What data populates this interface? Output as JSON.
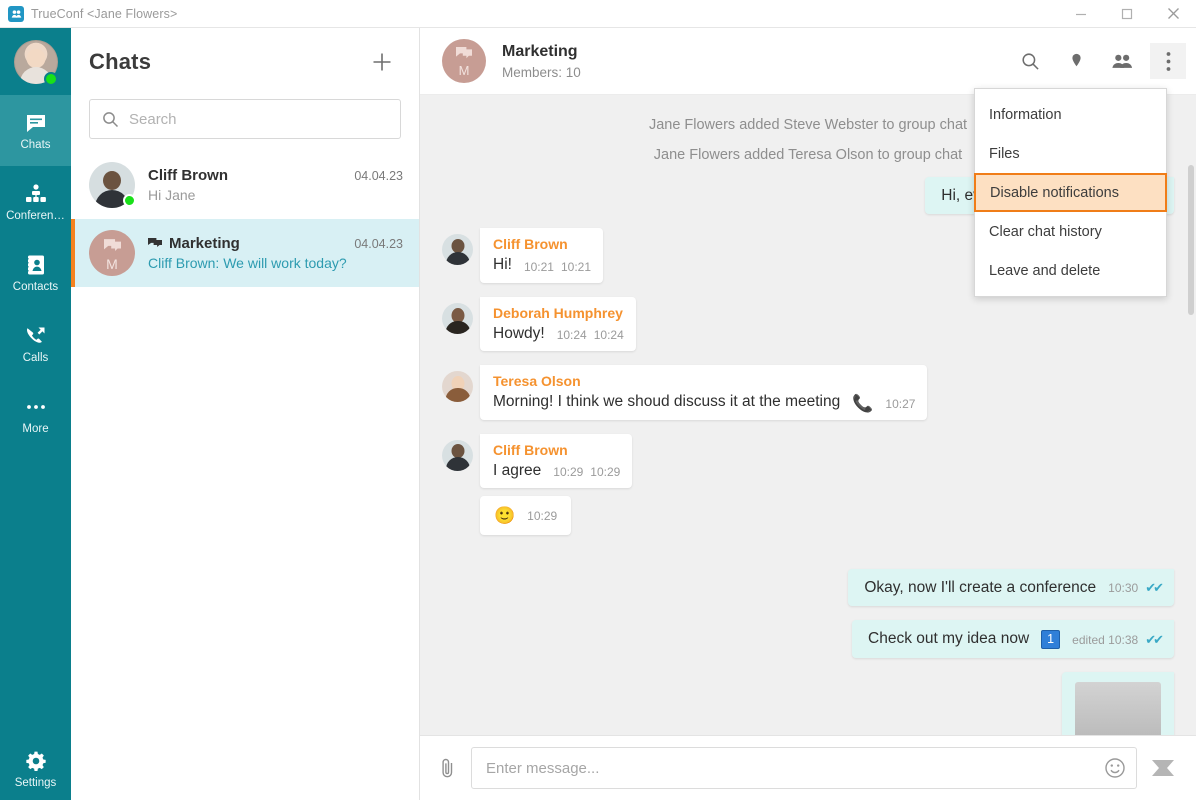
{
  "window": {
    "title": "TrueConf <Jane Flowers>",
    "logo_icon": "trueconf-logo-icon",
    "minimize_label": "—",
    "maximize_label": "☐",
    "close_label": "✕"
  },
  "rail": {
    "avatar_name": "user-avatar",
    "status": "online",
    "items": [
      {
        "label": "Chats",
        "icon": "chat-icon",
        "active": true
      },
      {
        "label": "Conferen…",
        "icon": "conference-icon",
        "active": false
      },
      {
        "label": "Contacts",
        "icon": "contacts-icon",
        "active": false
      },
      {
        "label": "Calls",
        "icon": "calls-icon",
        "active": false
      },
      {
        "label": "More",
        "icon": "more-dots-icon",
        "active": false
      }
    ],
    "settings": {
      "label": "Settings",
      "icon": "gear-icon"
    }
  },
  "chat_list": {
    "title": "Chats",
    "add_icon": "plus-icon",
    "search": {
      "placeholder": "Search",
      "value": "",
      "icon": "search-icon"
    },
    "rows": [
      {
        "name": "Cliff Brown",
        "date": "04.04.23",
        "preview": "Hi Jane",
        "preview_highlight": false,
        "selected": false,
        "is_group": false,
        "online": true
      },
      {
        "name": "Marketing",
        "date": "04.04.23",
        "preview": "Cliff Brown: We will work today?",
        "preview_highlight": true,
        "selected": true,
        "is_group": true,
        "avatar_letter": "M",
        "online": false
      }
    ]
  },
  "conversation": {
    "title": "Marketing",
    "subtitle": "Members: 10",
    "avatar_letter": "M",
    "actions": [
      {
        "name": "search-icon",
        "label": "Search"
      },
      {
        "name": "pin-icon",
        "label": "Pinned messages"
      },
      {
        "name": "participants-icon",
        "label": "Participants"
      },
      {
        "name": "kebab-menu-icon",
        "label": "More actions"
      }
    ],
    "system_messages": [
      "Jane Flowers added Steve Webster to group chat",
      "Jane Flowers added Teresa Olson to group chat"
    ],
    "messages": [
      {
        "direction": "out",
        "text": "Hi, everyone! What do you think",
        "time": "",
        "status": ""
      },
      {
        "direction": "in",
        "sender": "Cliff Brown",
        "avatar": "m",
        "text": "Hi!",
        "time": "10:21",
        "time2": "10:21"
      },
      {
        "direction": "in",
        "sender": "Deborah Humphrey",
        "avatar": "f1",
        "text": "Howdy!",
        "time": "10:24",
        "time2": "10:24"
      },
      {
        "direction": "in",
        "sender": "Teresa Olson",
        "avatar": "f2",
        "text": "Morning! I think we shoud discuss it at the meeting",
        "emoji": "📞",
        "time": "10:27",
        "time2": ""
      },
      {
        "direction": "in",
        "sender": "Cliff Brown",
        "avatar": "m",
        "text": "I agree",
        "time": "10:29",
        "time2": "10:29"
      },
      {
        "direction": "in",
        "sender": "",
        "emoji_only": "🙂",
        "time": "10:29",
        "time2": ""
      },
      {
        "direction": "out",
        "text": "Okay, now I'll create a conference",
        "time": "10:30",
        "status": "✔✔"
      },
      {
        "direction": "out",
        "text": "Check out my idea now",
        "badge": "1",
        "time": "edited 10:38",
        "status": "✔✔"
      },
      {
        "direction": "out",
        "attachment": "image-thumbnail",
        "text": "",
        "time": "",
        "status": ""
      }
    ]
  },
  "context_menu": {
    "items": [
      {
        "label": "Information",
        "highlighted": false
      },
      {
        "label": "Files",
        "highlighted": false
      },
      {
        "label": "Disable notifications",
        "highlighted": true
      },
      {
        "label": "Clear chat history",
        "highlighted": false
      },
      {
        "label": "Leave and delete",
        "highlighted": false
      }
    ],
    "highlight_border_color": "#f07d18",
    "highlight_bg_color": "#fde0c2"
  },
  "composer": {
    "attach_icon": "paperclip-icon",
    "placeholder": "Enter message...",
    "value": "",
    "emoji_icon": "smiley-icon",
    "send_icon": "send-icon"
  },
  "colors": {
    "rail_bg": "#0b7f8c",
    "rail_active": "#2d96a0",
    "selected_chat": "#d8f0f4",
    "accent_orange": "#f5821f",
    "sender_name": "#f5922f",
    "out_bubble": "#ddf5f3",
    "messages_bg": "#f0f0f0"
  }
}
